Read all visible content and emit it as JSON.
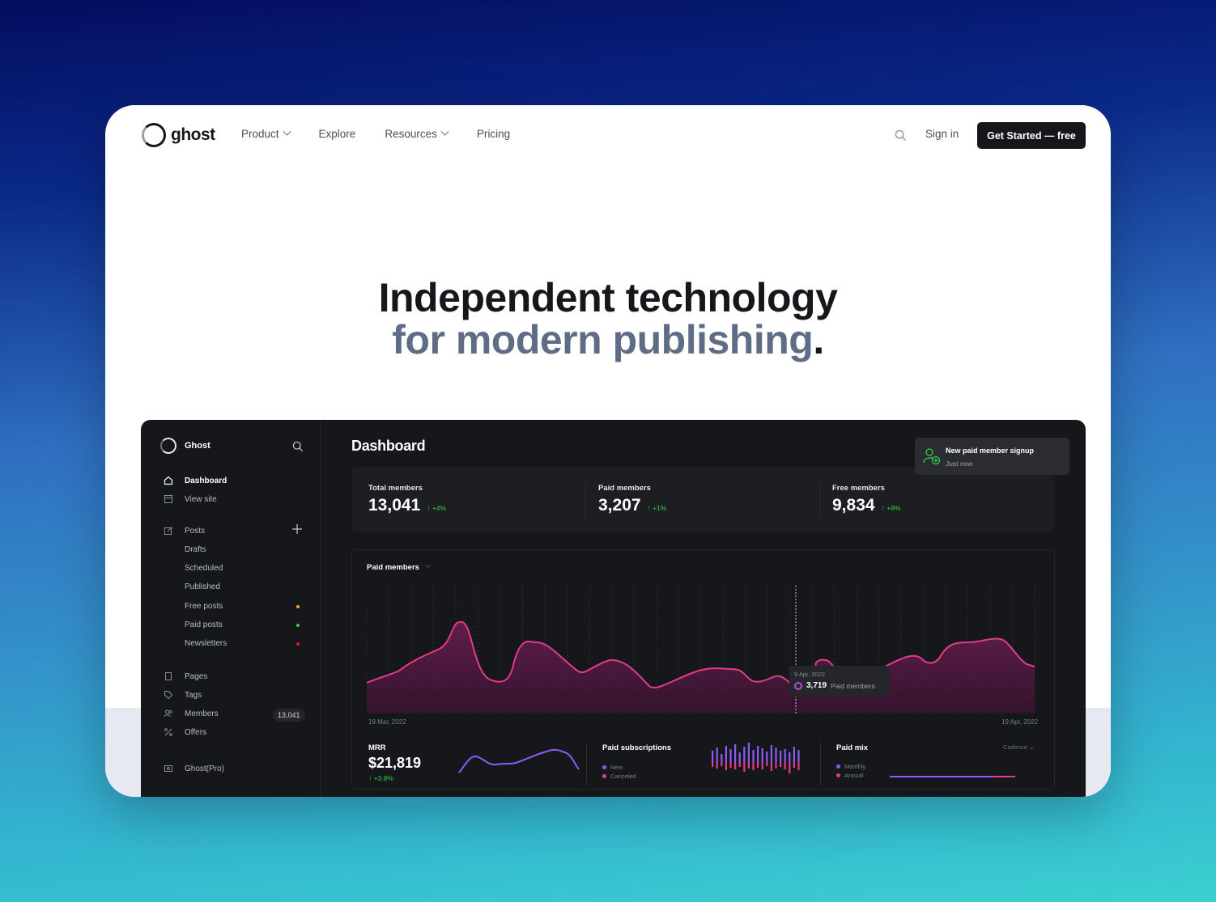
{
  "nav": {
    "logo_text": "ghost",
    "links": [
      {
        "label": "Product",
        "dropdown": true
      },
      {
        "label": "Explore",
        "dropdown": false
      },
      {
        "label": "Resources",
        "dropdown": true
      },
      {
        "label": "Pricing",
        "dropdown": false
      }
    ],
    "search_icon": "search-icon",
    "signin": "Sign in",
    "cta": "Get Started — free"
  },
  "hero": {
    "line1": "Independent technology",
    "line2": "for modern publishing",
    "line2_end": "."
  },
  "dashboard": {
    "sidebar": {
      "site_name": "Ghost",
      "items": [
        {
          "label": "Dashboard",
          "icon": "home-icon",
          "active": true
        },
        {
          "label": "View site",
          "icon": "layout-icon"
        },
        {
          "label": "Posts",
          "icon": "edit-icon"
        },
        {
          "label": "Drafts"
        },
        {
          "label": "Scheduled"
        },
        {
          "label": "Published"
        },
        {
          "label": "Free posts",
          "dot_color": "#f5a623"
        },
        {
          "label": "Paid posts",
          "dot_color": "#30cf43"
        },
        {
          "label": "Newsletters",
          "dot_color": "#f50b23"
        },
        {
          "label": "Pages",
          "icon": "page-icon"
        },
        {
          "label": "Tags",
          "icon": "tag-icon"
        },
        {
          "label": "Members",
          "icon": "members-icon",
          "badge": "13,041"
        },
        {
          "label": "Offers",
          "icon": "percent-icon"
        },
        {
          "label": "Ghost(Pro)",
          "icon": "pro-icon"
        }
      ]
    },
    "title": "Dashboard",
    "toast": {
      "title": "New paid member signup",
      "subtitle": "Just now",
      "icon": "user-add-icon"
    },
    "stats": [
      {
        "label": "Total members",
        "value": "13,041",
        "delta": "↑ +4%"
      },
      {
        "label": "Paid members",
        "value": "3,207",
        "delta": "↑ +1%"
      },
      {
        "label": "Free members",
        "value": "9,834",
        "delta": "↑ +8%"
      }
    ],
    "chart": {
      "title": "Paid members",
      "start_date": "19 Mar, 2022",
      "end_date": "19 Apr, 2022",
      "tooltip": {
        "date": "9 Apr, 2022",
        "value": "3,719",
        "label": "Paid members"
      },
      "accent": "#e03c8a"
    },
    "mrr": {
      "label": "MRR",
      "value": "$21,819",
      "delta": "↑ +3.8%"
    },
    "paid_subscriptions": {
      "label": "Paid subscriptions",
      "legend": [
        "New",
        "Canceled"
      ]
    },
    "paid_mix": {
      "label": "Paid mix",
      "legend": [
        "Monthly",
        "Annual"
      ],
      "dropdown": "Cadence"
    }
  }
}
